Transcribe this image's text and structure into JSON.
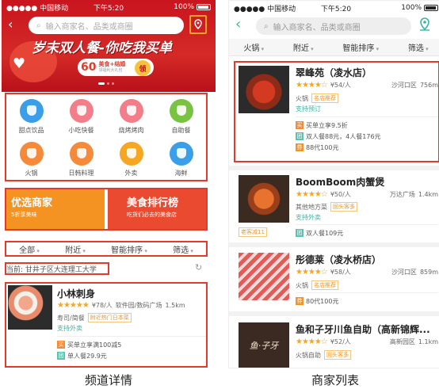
{
  "left": {
    "status": {
      "carrier": "●●●●● 中国移动",
      "wifi": "wifi-icon",
      "time": "下午5:20",
      "battery_pct": "100%"
    },
    "search": {
      "placeholder": "输入商家名、品类或商圈"
    },
    "banner": {
      "title": "岁末双人餐-你吃我买单",
      "pill_num": "60",
      "pill_l1": "美食+结婚",
      "pill_l2": "领福利大礼包",
      "pill_btn": "领"
    },
    "categories": [
      {
        "label": "甜点饮品",
        "icon": "cup-icon",
        "color": "#3a9ee8"
      },
      {
        "label": "小吃快餐",
        "icon": "burger-icon",
        "color": "#f47d8a"
      },
      {
        "label": "烧烤烤肉",
        "icon": "grill-icon",
        "color": "#f47d8a"
      },
      {
        "label": "自助餐",
        "icon": "buffet-icon",
        "color": "#78c442"
      },
      {
        "label": "火锅",
        "icon": "hotpot-icon",
        "color": "#f58a3a"
      },
      {
        "label": "日韩料理",
        "icon": "sushi-icon",
        "color": "#f58a3a"
      },
      {
        "label": "外卖",
        "icon": "takeout-icon",
        "color": "#f6a623"
      },
      {
        "label": "海鲜",
        "icon": "fish-icon",
        "color": "#3a9ee8"
      }
    ],
    "promos": [
      {
        "title": "优选商家",
        "sub": "5折享美味",
        "color": "#f59322"
      },
      {
        "title": "美食排行榜",
        "sub": "吃货们必去的美食店",
        "color": "#ea4a2f"
      }
    ],
    "filters": [
      "全部",
      "附近",
      "智能排序",
      "筛选"
    ],
    "location": {
      "label": "当前: 甘井子区大连理工大学"
    },
    "shop": {
      "name": "小林刺身",
      "stars": "★★★★★",
      "price": "¥78/人",
      "area": "软件园/数码广场",
      "dist": "1.5km",
      "cuisine": "寿司/简餐",
      "badge": "附近热门日本菜",
      "delivery": "支持外卖",
      "deals": [
        {
          "icon": "买",
          "text": "买单立享满100减5",
          "color": "#f58a3a"
        },
        {
          "icon": "团",
          "text": "单人餐29.9元",
          "color": "#5cc2b0"
        }
      ]
    },
    "caption": "频道详情"
  },
  "right": {
    "status": {
      "carrier": "●●●●● 中国移动",
      "wifi": "wifi-icon",
      "time": "下午5:20",
      "battery_pct": "100%"
    },
    "search": {
      "placeholder": "输入商家名、品类或商圈"
    },
    "filters": [
      "火锅",
      "附近",
      "智能排序",
      "筛选"
    ],
    "shops": [
      {
        "name": "翠峰苑（凌水店）",
        "stars": "★★★★☆",
        "price": "¥54/人",
        "area": "沙河口区",
        "dist": "756m",
        "cuisine": "火锅",
        "badge": "名店推荐",
        "service": "支持预订",
        "deals": [
          {
            "icon": "买",
            "text": "买单立享9.5折",
            "color": "#f58a3a"
          },
          {
            "icon": "团",
            "text": "双人餐88元，4人餐176元",
            "color": "#5cc2b0"
          },
          {
            "icon": "券",
            "text": "88代100元",
            "color": "#f59322"
          }
        ]
      },
      {
        "name": "BoomBoom肉蟹煲",
        "stars": "★★★★☆",
        "price": "¥50/人",
        "area": "万达广场",
        "dist": "1.4km",
        "cuisine": "其他地方菜",
        "badge": "回头客多",
        "service": "支持外卖",
        "side_tag": "老客减11",
        "deals": [
          {
            "icon": "团",
            "text": "双人餐109元",
            "color": "#5cc2b0"
          }
        ]
      },
      {
        "name": "彤德莱（凌水桥店）",
        "stars": "★★★★☆",
        "price": "¥58/人",
        "area": "沙河口区",
        "dist": "859m",
        "cuisine": "火锅",
        "badge": "名店推荐",
        "deals": [
          {
            "icon": "券",
            "text": "80代100元",
            "color": "#f59322"
          }
        ]
      },
      {
        "name": "鱼和子牙川鱼自助（高新锦辉...",
        "stars": "★★★★☆",
        "price": "¥52/人",
        "area": "高新园区",
        "dist": "1.1km",
        "cuisine": "火锅自助",
        "badge": "回头客多",
        "logo_text": "鱼·子牙"
      }
    ],
    "caption": "商家列表"
  }
}
